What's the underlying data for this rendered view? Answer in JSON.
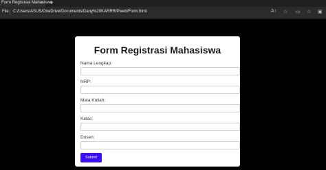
{
  "browser": {
    "tab_title": "Form Registrasi Mahasiswa",
    "tab_close": "×",
    "new_tab": "+",
    "file_label": "File",
    "url": "C:/Users/ASUS/OneDrive/Documents/Dany%20KARRR/Pweb/Form.html",
    "icons": {
      "read_aloud": "A↑",
      "favorite": "☆",
      "split_screen": "▭",
      "favorites_bar": "☆",
      "collections": "▣",
      "profile": "●"
    }
  },
  "form": {
    "title": "Form Registrasi Mahasiswa",
    "fields": [
      {
        "label": "Nama Lengkap:",
        "value": ""
      },
      {
        "label": "NRP:",
        "value": ""
      },
      {
        "label": "Mata Kuliah:",
        "value": ""
      },
      {
        "label": "Kelas:",
        "value": ""
      },
      {
        "label": "Dosen:",
        "value": ""
      }
    ],
    "submit_label": "Submit",
    "accent_color": "#3b0ff5"
  }
}
